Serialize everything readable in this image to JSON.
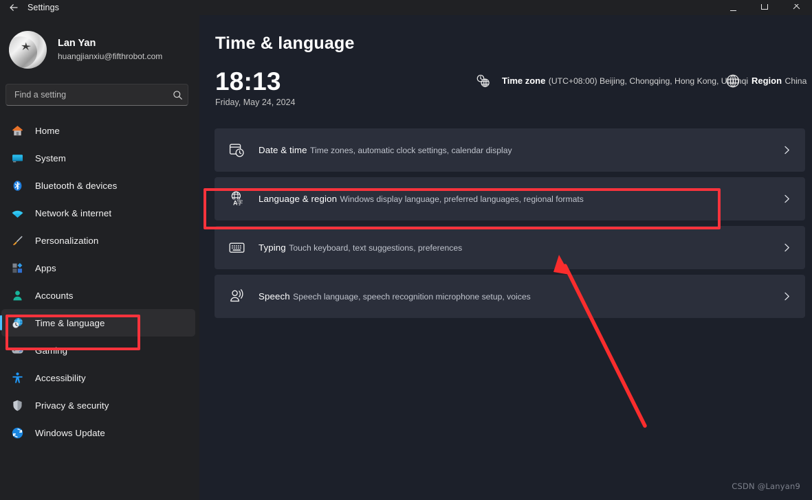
{
  "window": {
    "title": "Settings",
    "back_icon": "back-arrow-icon",
    "minimize_label": "Minimize",
    "maximize_label": "Maximize",
    "close_label": "Close"
  },
  "sidebar": {
    "profile": {
      "name": "Lan Yan",
      "email": "huangjianxiu@fifthrobot.com",
      "avatar_alt": "User avatar"
    },
    "search": {
      "placeholder": "Find a setting",
      "value": "",
      "icon": "search-icon"
    },
    "items": [
      {
        "label": "Home",
        "icon": "home-icon",
        "selected": false
      },
      {
        "label": "System",
        "icon": "system-monitor-icon",
        "selected": false
      },
      {
        "label": "Bluetooth & devices",
        "icon": "bluetooth-icon",
        "selected": false
      },
      {
        "label": "Network & internet",
        "icon": "wifi-icon",
        "selected": false
      },
      {
        "label": "Personalization",
        "icon": "paintbrush-icon",
        "selected": false
      },
      {
        "label": "Apps",
        "icon": "apps-grid-icon",
        "selected": false
      },
      {
        "label": "Accounts",
        "icon": "person-icon",
        "selected": false
      },
      {
        "label": "Time & language",
        "icon": "clock-globe-icon",
        "selected": true
      },
      {
        "label": "Gaming",
        "icon": "gamepad-icon",
        "selected": false
      },
      {
        "label": "Accessibility",
        "icon": "accessibility-person-icon",
        "selected": false
      },
      {
        "label": "Privacy & security",
        "icon": "shield-icon",
        "selected": false
      },
      {
        "label": "Windows Update",
        "icon": "update-sync-icon",
        "selected": false
      }
    ]
  },
  "main": {
    "page_title": "Time & language",
    "clock": {
      "time": "18:13",
      "date": "Friday, May 24, 2024"
    },
    "time_zone": {
      "icon": "clock-globe-icon",
      "title": "Time zone",
      "value": "(UTC+08:00) Beijing, Chongqing, Hong Kong, Urumqi"
    },
    "region": {
      "icon": "globe-icon",
      "title": "Region",
      "value": "China"
    },
    "cards": [
      {
        "icon": "calendar-clock-icon",
        "title": "Date & time",
        "subtitle": "Time zones, automatic clock settings, calendar display",
        "chevron": "chevron-right-icon"
      },
      {
        "icon": "translate-globe-icon",
        "title": "Language & region",
        "subtitle": "Windows display language, preferred languages, regional formats",
        "chevron": "chevron-right-icon"
      },
      {
        "icon": "keyboard-icon",
        "title": "Typing",
        "subtitle": "Touch keyboard, text suggestions, preferences",
        "chevron": "chevron-right-icon"
      },
      {
        "icon": "speech-icon",
        "title": "Speech",
        "subtitle": "Speech language, speech recognition microphone setup, voices",
        "chevron": "chevron-right-icon"
      }
    ]
  },
  "annotations": {
    "highlight_color": "#f7333c",
    "arrow_color": "#fa2d2d",
    "highlight_sidebar_target": "Time & language",
    "highlight_card_target": "Language & region"
  },
  "watermark": "CSDN @Lanyan9",
  "colors": {
    "accent": "#4cc2ff",
    "sidebar_bg": "#202124",
    "main_bg": "#1c202a",
    "card_bg": "#2b2f3b",
    "selected_bg": "#2d2d30"
  }
}
